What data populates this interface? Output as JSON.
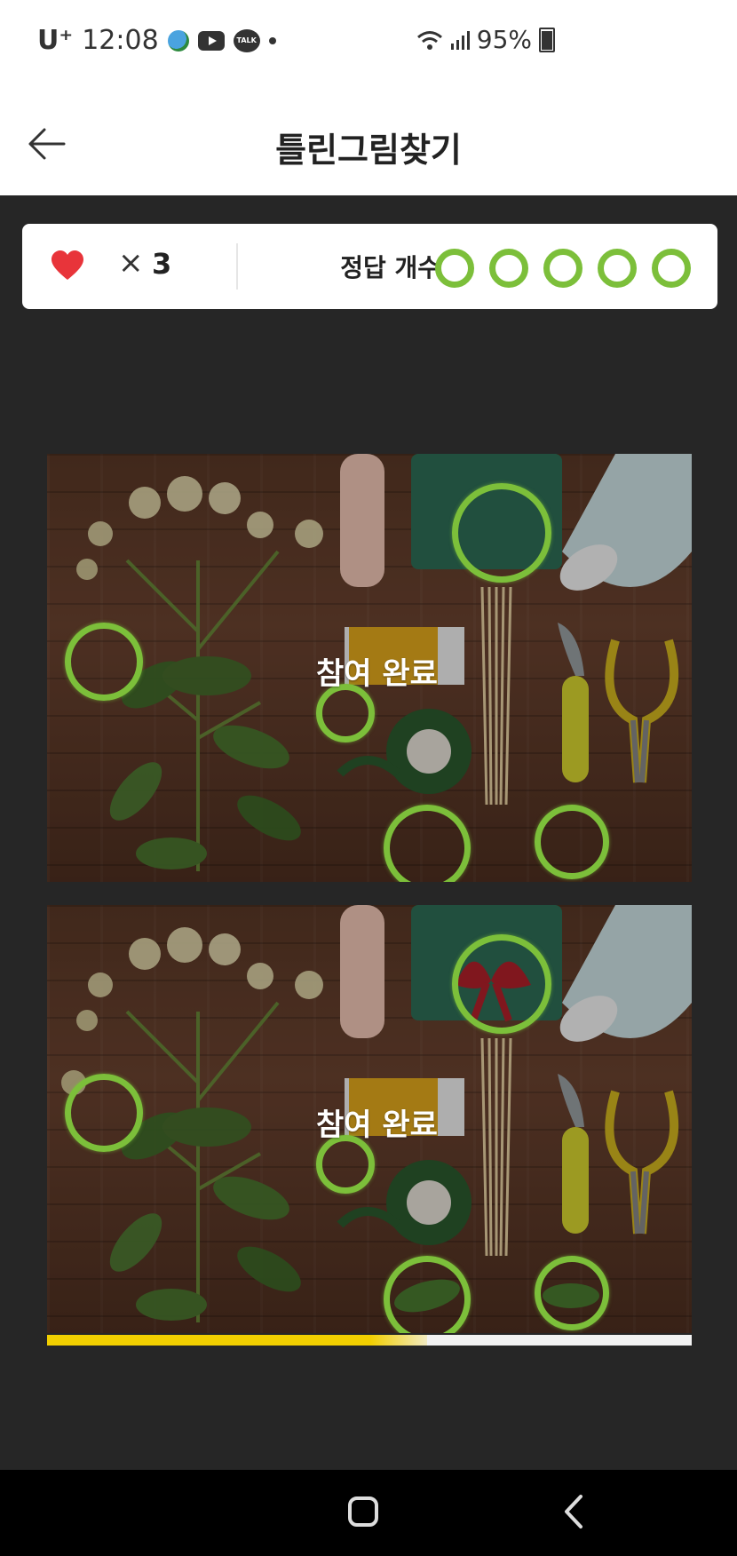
{
  "status_bar": {
    "carrier": "U⁺",
    "time": "12:08",
    "notif_icons": [
      "globe-icon",
      "youtube-icon",
      "kakaotalk-icon",
      "dot-icon"
    ],
    "talk_label": "TALK",
    "battery": "95%"
  },
  "app_bar": {
    "title": "틀린그림찾기",
    "back_icon": "arrow-left-icon"
  },
  "status_card": {
    "lives_icon": "heart-icon",
    "lives_times": "×",
    "lives_count": "3",
    "answer_label": "정답 개수",
    "answers_total": 5,
    "answers_found": 5
  },
  "puzzle": {
    "completion_text": "참여 완료",
    "found_spots": 5
  },
  "progress": {
    "fraction": 0.59
  },
  "colors": {
    "accent_green": "#7cbf3a",
    "heart_red": "#e8343a",
    "progress_yellow": "#f2cf00",
    "background": "#262626"
  },
  "nav_bar": {
    "home_icon": "home-square-icon",
    "back_icon": "chevron-left-icon"
  }
}
